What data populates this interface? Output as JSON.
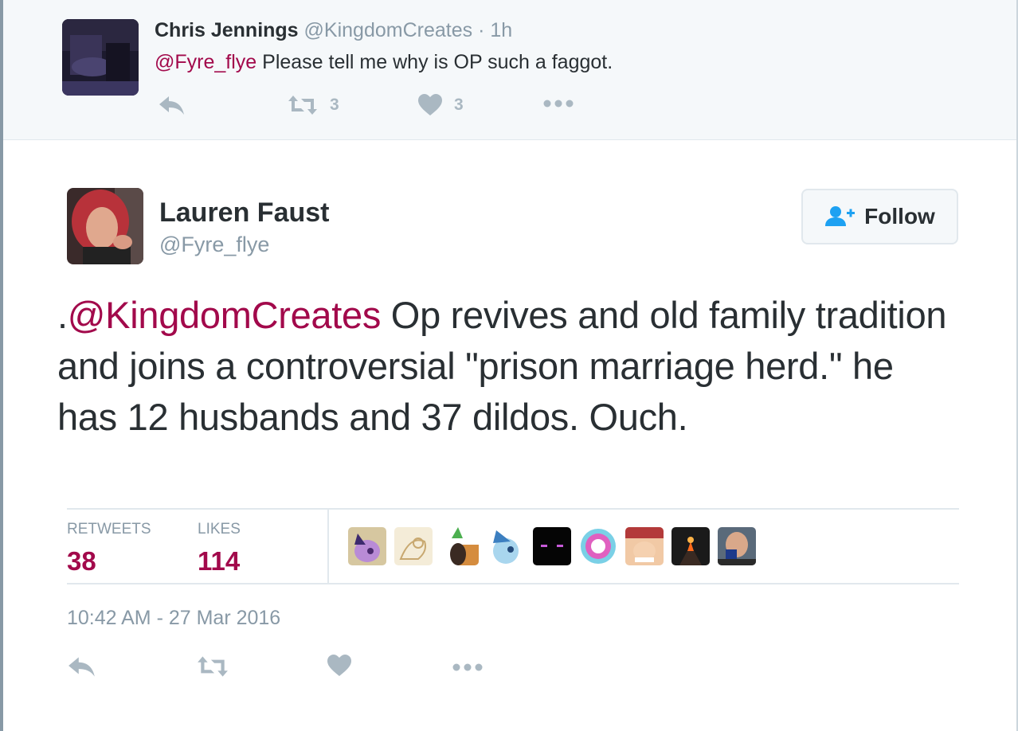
{
  "parent_tweet": {
    "author_name": "Chris Jennings",
    "author_handle": "@KingdomCreates",
    "separator": "·",
    "time": "1h",
    "mention": "@Fyre_flye",
    "text": "Please tell me why is OP such a faggot.",
    "retweet_count": "3",
    "like_count": "3",
    "icons": [
      "reply-icon",
      "retweet-icon",
      "heart-icon",
      "more-icon"
    ]
  },
  "main_tweet": {
    "author_name": "Lauren Faust",
    "author_handle": "@Fyre_flye",
    "follow_label": "Follow",
    "text_prefix": ".",
    "mention": "@KingdomCreates",
    "text": " Op revives and old family tradition and joins a controversial \"prison marriage herd.\" he has 12 husbands and 37 dildos. Ouch.",
    "retweets_label": "RETWEETS",
    "retweets_count": "38",
    "likes_label": "LIKES",
    "likes_count": "114",
    "timestamp": "10:42 AM - 27 Mar 2016",
    "icons": [
      "reply-icon",
      "retweet-icon",
      "heart-icon",
      "more-icon"
    ]
  },
  "colors": {
    "mention": "#a2094b",
    "count": "#a2094b",
    "muted": "#8899a6",
    "icon": "#aab8c2",
    "follow_icon": "#1da1f2",
    "parent_bg": "#f5f8fa"
  }
}
